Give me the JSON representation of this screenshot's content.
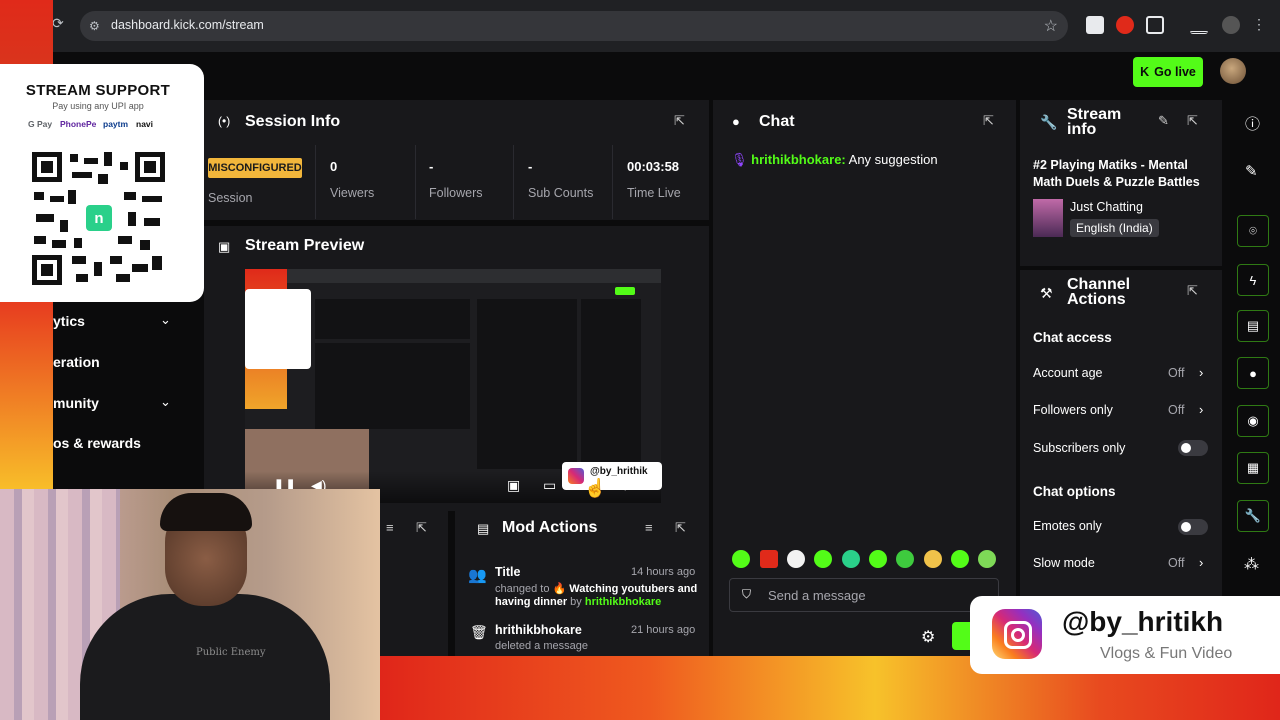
{
  "browser": {
    "url": "dashboard.kick.com/stream"
  },
  "header": {
    "go_live_label": "Go live"
  },
  "sidebar": {
    "items": [
      {
        "label": "ytics",
        "has_chevron": true
      },
      {
        "label": "eration",
        "has_chevron": false
      },
      {
        "label": "munity",
        "has_chevron": true
      },
      {
        "label": "os & rewards",
        "has_chevron": false
      }
    ]
  },
  "session": {
    "title": "Session Info",
    "status_badge": "MISCONFIGURED",
    "status_label": "Session",
    "stats": [
      {
        "value": "0",
        "label": "Viewers"
      },
      {
        "value": "-",
        "label": "Followers"
      },
      {
        "value": "-",
        "label": "Sub Counts"
      },
      {
        "value": "00:03:58",
        "label": "Time Live"
      }
    ]
  },
  "preview": {
    "title": "Stream Preview"
  },
  "chat": {
    "title": "Chat",
    "messages": [
      {
        "user": "hrithikbhokare:",
        "text": " Any suggestion"
      }
    ],
    "input_placeholder": "Send a message"
  },
  "stream_info": {
    "title": "Stream info",
    "stream_title": "#2 Playing Matiks - Mental Math Duels & Puzzle Battles ...",
    "category": "Just Chatting",
    "language": "English (India)"
  },
  "channel_actions": {
    "title": "Channel Actions",
    "sections": [
      {
        "heading": "Chat access",
        "rows": [
          {
            "label": "Account age",
            "value": "Off",
            "control": "arrow"
          },
          {
            "label": "Followers only",
            "value": "Off",
            "control": "arrow"
          },
          {
            "label": "Subscribers only",
            "value": "",
            "control": "toggle"
          }
        ]
      },
      {
        "heading": "Chat options",
        "rows": [
          {
            "label": "Emotes only",
            "value": "",
            "control": "toggle"
          },
          {
            "label": "Slow mode",
            "value": "Off",
            "control": "arrow"
          }
        ]
      }
    ]
  },
  "mod_actions": {
    "title": "Mod Actions",
    "entries": [
      {
        "title": "Title",
        "time": "14 hours ago",
        "prefix": "changed to ",
        "emoji": "🔥",
        "detail": " Watching youtubers and having dinner",
        "by": " by ",
        "actor": "hrithikbhokare"
      },
      {
        "title": "hrithikbhokare",
        "time": "21 hours ago",
        "detail": "deleted a message"
      }
    ]
  },
  "overlay_support": {
    "title": "STREAM SUPPORT",
    "subtitle": "Pay using any UPI app",
    "apps": [
      "G Pay",
      "PhonePe",
      "paytm",
      "navi"
    ]
  },
  "overlay_instagram": {
    "handle": "@by_hritikh",
    "tagline": "Vlogs & Fun Video"
  },
  "preview_tag": {
    "handle": "@by_hrithik"
  },
  "webcam": {
    "shirt_text": "Public Enemy"
  },
  "colors": {
    "accent": "#53fc18",
    "panel": "#18181b",
    "badge": "#f2b63b"
  }
}
